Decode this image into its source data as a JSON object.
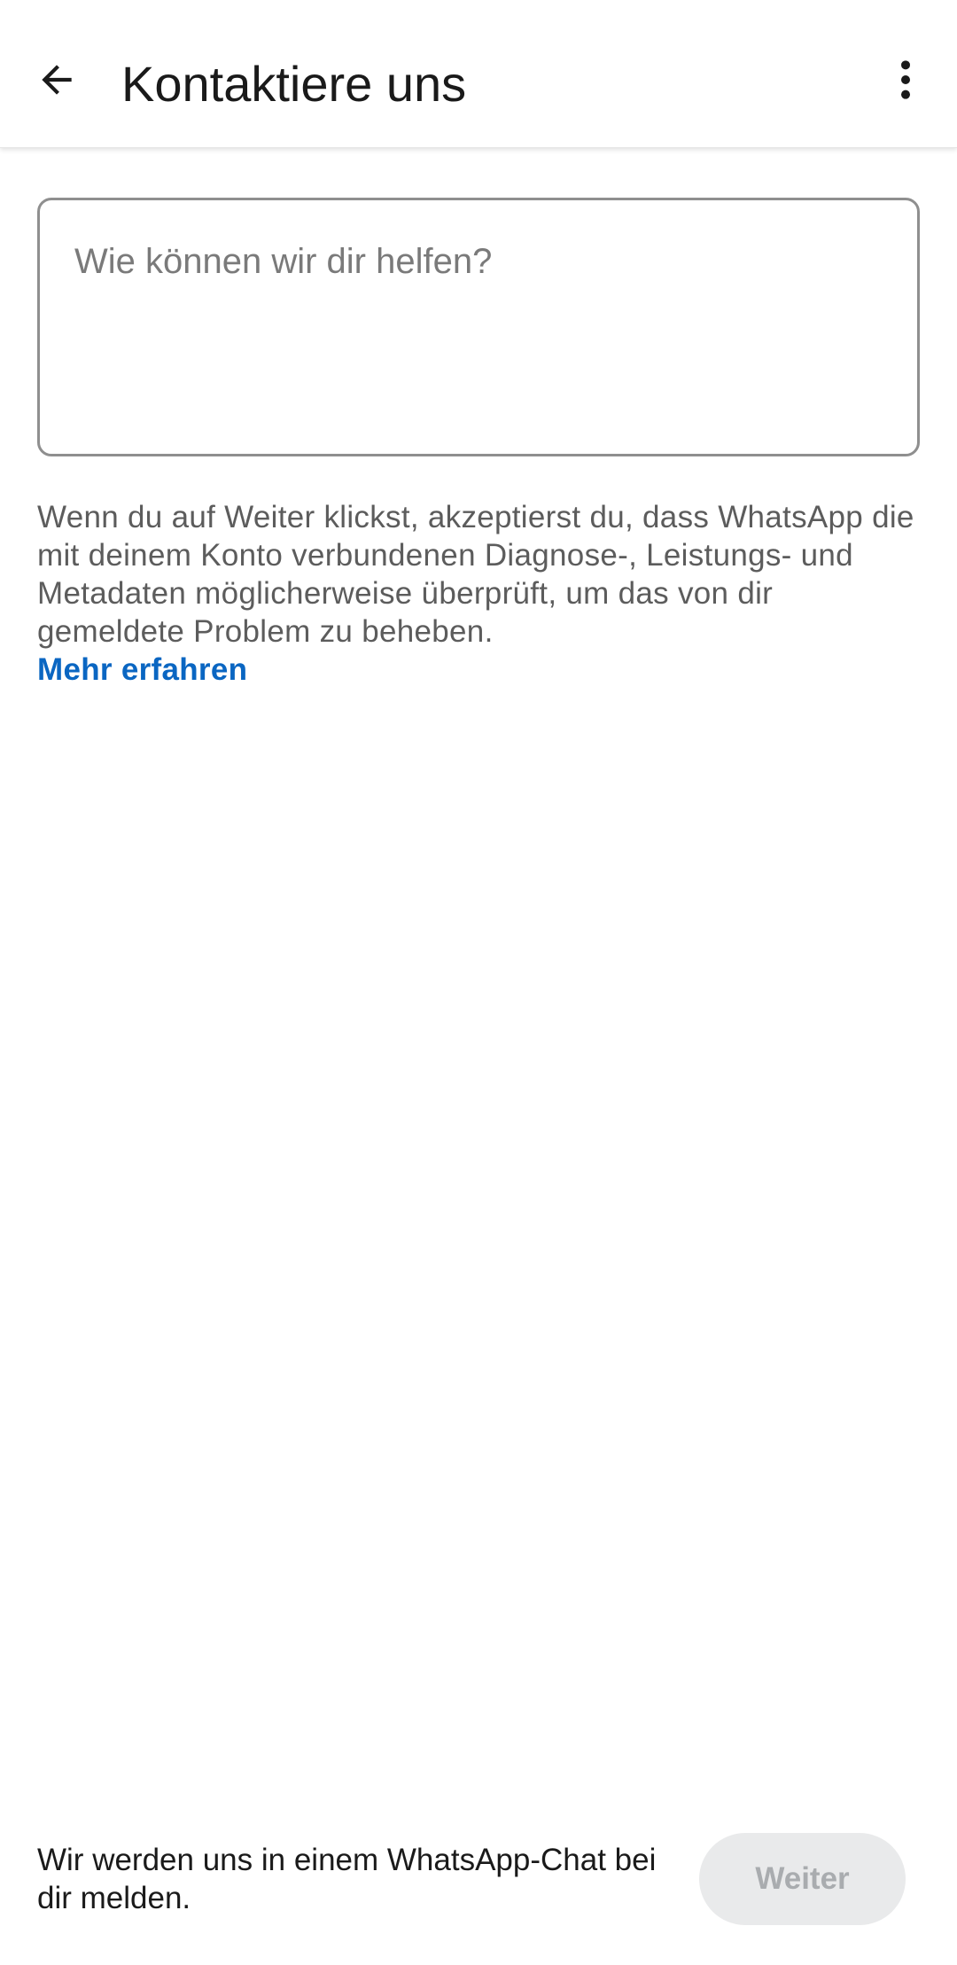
{
  "appbar": {
    "title": "Kontaktiere uns",
    "back_icon": "arrow-left-icon",
    "menu_icon": "more-vertical-icon"
  },
  "form": {
    "message_placeholder": "Wie können wir dir helfen?",
    "message_value": ""
  },
  "disclaimer": {
    "text": "Wenn du auf Weiter klickst, akzeptierst du, dass WhatsApp die mit deinem Konto verbundenen Diagnose-, Leistungs- und Metadaten möglicherweise überprüft, um das von dir gemeldete Problem zu beheben.",
    "learn_more_label": "Mehr erfahren"
  },
  "footer": {
    "note": "Wir werden uns in einem WhatsApp-Chat bei dir melden.",
    "next_label": "Weiter",
    "next_enabled": false
  },
  "colors": {
    "link": "#0a66c2",
    "disabled_button_bg": "#e9eaeb",
    "disabled_button_text": "#a9acaf"
  }
}
